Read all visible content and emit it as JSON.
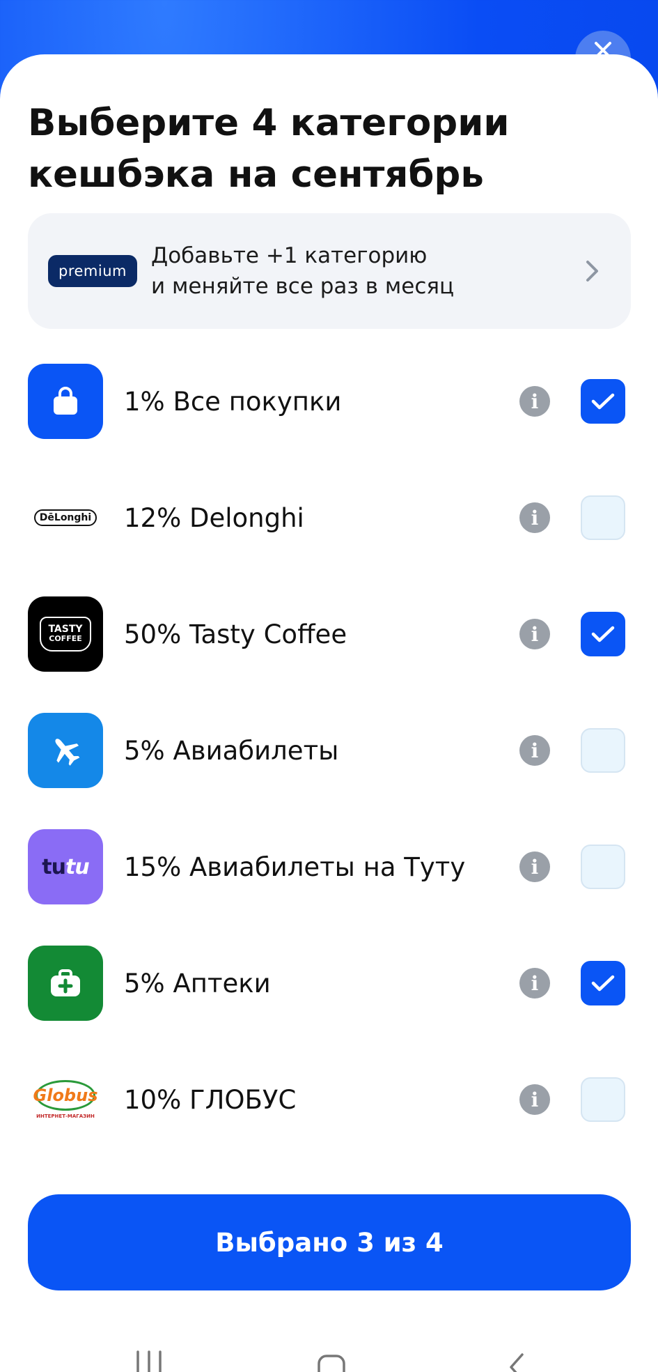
{
  "header": {
    "title_line1": "Выберите 4 категории",
    "title_line2": "кешбэка на сентябрь",
    "close_icon": "close-icon"
  },
  "promo": {
    "badge": "premium",
    "line1": "Добавьте +1 категорию",
    "line2": "и меняйте все раз в месяц",
    "chevron": "›"
  },
  "categories": [
    {
      "label": "1% Все покупки",
      "checked": true,
      "icon": "shopping-bag-icon",
      "icon_bg": "#0a55f5"
    },
    {
      "label": "12% Delonghi",
      "checked": false,
      "icon": "delonghi-logo",
      "logo_text": "DēLonghi",
      "icon_bg": "#ffffff"
    },
    {
      "label": "50% Tasty Coffee",
      "checked": true,
      "icon": "tasty-coffee-logo",
      "logo_line1": "TASTY",
      "logo_line2": "COFFEE",
      "icon_bg": "#000000"
    },
    {
      "label": "5% Авиабилеты",
      "checked": false,
      "icon": "airplane-icon",
      "icon_bg": "#1488e8"
    },
    {
      "label": "15% Авиабилеты на Туту",
      "checked": false,
      "icon": "tutu-logo",
      "logo_text_a": "tu",
      "logo_text_b": "tu",
      "icon_bg": "#8a6cf5"
    },
    {
      "label": "5% Аптеки",
      "checked": true,
      "icon": "pharmacy-icon",
      "icon_bg": "#138a35"
    },
    {
      "label": "10% ГЛОБУС",
      "checked": false,
      "icon": "globus-logo",
      "logo_text": "Globus",
      "logo_sub": "ИНТЕРНЕТ-МАГАЗИН",
      "icon_bg": "#ffffff"
    }
  ],
  "info_glyph": "i",
  "cta": {
    "label": "Выбрано 3 из 4"
  },
  "colors": {
    "accent": "#0a55f5",
    "checkbox_empty": "#e9f5fd",
    "info_gray": "#9aa0a8"
  }
}
